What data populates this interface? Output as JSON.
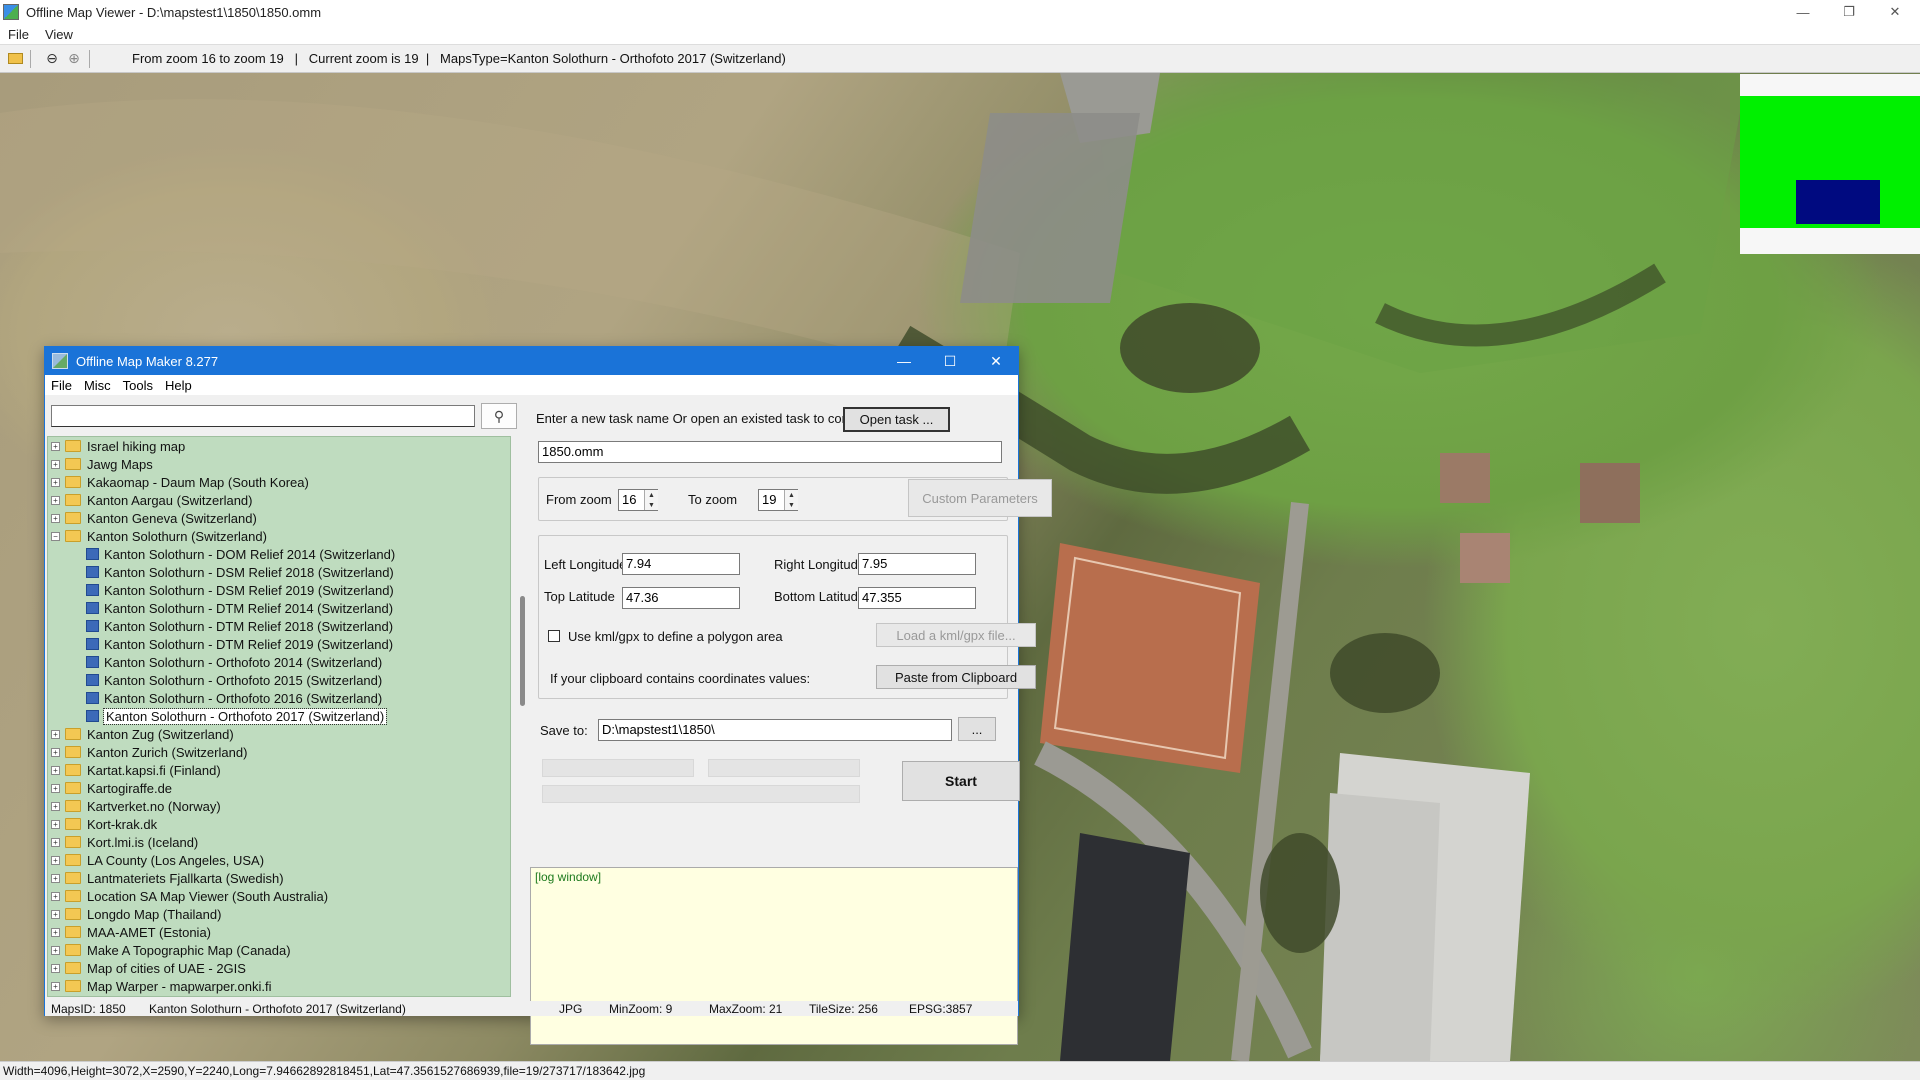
{
  "window": {
    "title": "Offline Map Viewer - D:\\mapstest1\\1850\\1850.omm"
  },
  "menu": [
    "File",
    "View"
  ],
  "toolbar": {
    "info": "From zoom 16 to zoom 19   |   Current zoom is 19  |   MapsType=Kanton Solothurn - Orthofoto 2017 (Switzerland)"
  },
  "status": "Width=4096,Height=3072,X=2590,Y=2240,Long=7.94662892818451,Lat=47.3561527686939,file=19/273717/183642.jpg",
  "dialog": {
    "title": "Offline Map Maker 8.277",
    "menu": [
      "File",
      "Misc",
      "Tools",
      "Help"
    ],
    "search_value": "",
    "tree": [
      {
        "label": "Israel hiking map",
        "type": "folder",
        "state": "collapsed"
      },
      {
        "label": "Jawg Maps",
        "type": "folder",
        "state": "collapsed"
      },
      {
        "label": "Kakaomap - Daum Map (South Korea)",
        "type": "folder",
        "state": "collapsed"
      },
      {
        "label": "Kanton Aargau (Switzerland)",
        "type": "folder",
        "state": "collapsed"
      },
      {
        "label": "Kanton Geneva (Switzerland)",
        "type": "folder",
        "state": "collapsed"
      },
      {
        "label": "Kanton Solothurn (Switzerland)",
        "type": "folder",
        "state": "expanded"
      },
      {
        "label": "Kanton Solothurn - DOM Relief 2014 (Switzerland)",
        "type": "map"
      },
      {
        "label": "Kanton Solothurn - DSM Relief 2018 (Switzerland)",
        "type": "map"
      },
      {
        "label": "Kanton Solothurn - DSM Relief 2019 (Switzerland)",
        "type": "map"
      },
      {
        "label": "Kanton Solothurn - DTM Relief 2014 (Switzerland)",
        "type": "map"
      },
      {
        "label": "Kanton Solothurn - DTM Relief 2018 (Switzerland)",
        "type": "map"
      },
      {
        "label": "Kanton Solothurn - DTM Relief 2019 (Switzerland)",
        "type": "map"
      },
      {
        "label": "Kanton Solothurn - Orthofoto 2014 (Switzerland)",
        "type": "map"
      },
      {
        "label": "Kanton Solothurn - Orthofoto 2015 (Switzerland)",
        "type": "map"
      },
      {
        "label": "Kanton Solothurn - Orthofoto 2016 (Switzerland)",
        "type": "map"
      },
      {
        "label": "Kanton Solothurn - Orthofoto 2017 (Switzerland)",
        "type": "map",
        "selected": true
      },
      {
        "label": "Kanton Zug (Switzerland)",
        "type": "folder",
        "state": "collapsed"
      },
      {
        "label": "Kanton Zurich (Switzerland)",
        "type": "folder",
        "state": "collapsed"
      },
      {
        "label": "Kartat.kapsi.fi (Finland)",
        "type": "folder",
        "state": "collapsed"
      },
      {
        "label": "Kartogiraffe.de",
        "type": "folder",
        "state": "collapsed"
      },
      {
        "label": "Kartverket.no (Norway)",
        "type": "folder",
        "state": "collapsed"
      },
      {
        "label": "Kort-krak.dk",
        "type": "folder",
        "state": "collapsed"
      },
      {
        "label": "Kort.lmi.is (Iceland)",
        "type": "folder",
        "state": "collapsed"
      },
      {
        "label": "LA County (Los Angeles, USA)",
        "type": "folder",
        "state": "collapsed"
      },
      {
        "label": "Lantmateriets Fjallkarta (Swedish)",
        "type": "folder",
        "state": "collapsed"
      },
      {
        "label": "Location SA Map Viewer (South Australia)",
        "type": "folder",
        "state": "collapsed"
      },
      {
        "label": "Longdo Map (Thailand)",
        "type": "folder",
        "state": "collapsed"
      },
      {
        "label": "MAA-AMET (Estonia)",
        "type": "folder",
        "state": "collapsed"
      },
      {
        "label": "Make A Topographic Map (Canada)",
        "type": "folder",
        "state": "collapsed"
      },
      {
        "label": "Map of cities of UAE - 2GIS",
        "type": "folder",
        "state": "collapsed"
      },
      {
        "label": "Map Warper - mapwarper.onki.fi",
        "type": "folder",
        "state": "collapsed"
      }
    ],
    "task_label": "Enter a new task name Or open an existed task to continue:",
    "open_task": "Open task ...",
    "task_name": "1850.omm",
    "from_zoom_label": "From zoom",
    "from_zoom": "16",
    "to_zoom_label": "To zoom",
    "to_zoom": "19",
    "custom_params": "Custom Parameters",
    "left_lon_label": "Left Longitude",
    "left_lon": "7.94",
    "right_lon_label": "Right Longitude",
    "right_lon": "7.95",
    "top_lat_label": "Top Latitude",
    "top_lat": "47.36",
    "bottom_lat_label": "Bottom Latitude",
    "bottom_lat": "47.355",
    "kml_label": "Use kml/gpx to define a polygon area",
    "kml_checked": false,
    "load_kml": "Load a kml/gpx file...",
    "clipboard_label": "If your clipboard contains coordinates values:",
    "paste_clipboard": "Paste from Clipboard",
    "save_label": "Save to:",
    "save_path": "D:\\mapstest1\\1850\\",
    "browse": "...",
    "start": "Start",
    "log": "[log window]",
    "status": {
      "mapsid": "MapsID: 1850",
      "name": "Kanton Solothurn - Orthofoto 2017 (Switzerland)",
      "format": "JPG",
      "minzoom": "MinZoom: 9",
      "maxzoom": "MaxZoom: 21",
      "tilesize": "TileSize: 256",
      "epsg": "EPSG:3857"
    }
  }
}
